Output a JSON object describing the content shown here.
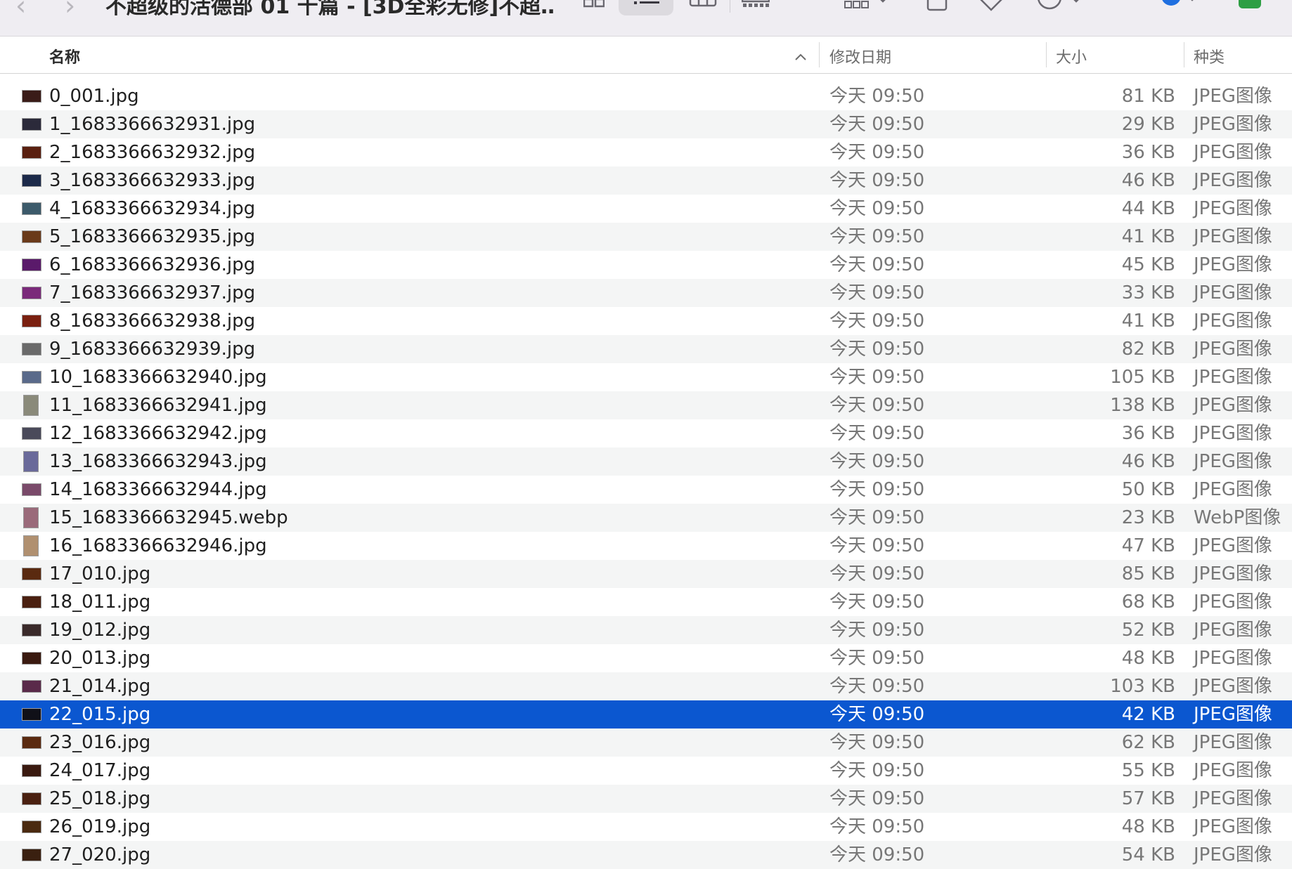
{
  "toolbar": {
    "back_glyph": "‹",
    "forward_glyph": "›",
    "title": "不超级的活德部 01 十篇 - [3D全彩无修]不超…",
    "view_icons": [
      "grid-view-icon",
      "list-view-icon",
      "column-view-icon",
      "gallery-view-icon"
    ],
    "active_view": "list"
  },
  "columns": {
    "name": "名称",
    "date": "修改日期",
    "size": "大小",
    "kind": "种类"
  },
  "colors": {
    "selection": "#0b57d0",
    "alt_row": "#f4f5f5",
    "toolbar_bg": "#efedf2"
  },
  "files": [
    {
      "name": "0_001.jpg",
      "date": "今天 09:50",
      "size": "81 KB",
      "kind": "JPEG图像",
      "thumb": "#3a1c18"
    },
    {
      "name": "1_1683366632931.jpg",
      "date": "今天 09:50",
      "size": "29 KB",
      "kind": "JPEG图像",
      "thumb": "#2b2a3a"
    },
    {
      "name": "2_1683366632932.jpg",
      "date": "今天 09:50",
      "size": "36 KB",
      "kind": "JPEG图像",
      "thumb": "#5a2010"
    },
    {
      "name": "3_1683366632933.jpg",
      "date": "今天 09:50",
      "size": "46 KB",
      "kind": "JPEG图像",
      "thumb": "#1c2a4a"
    },
    {
      "name": "4_1683366632934.jpg",
      "date": "今天 09:50",
      "size": "44 KB",
      "kind": "JPEG图像",
      "thumb": "#3c5a6a"
    },
    {
      "name": "5_1683366632935.jpg",
      "date": "今天 09:50",
      "size": "41 KB",
      "kind": "JPEG图像",
      "thumb": "#6a3a1a"
    },
    {
      "name": "6_1683366632936.jpg",
      "date": "今天 09:50",
      "size": "45 KB",
      "kind": "JPEG图像",
      "thumb": "#5a1a6a"
    },
    {
      "name": "7_1683366632937.jpg",
      "date": "今天 09:50",
      "size": "33 KB",
      "kind": "JPEG图像",
      "thumb": "#7a2a7a"
    },
    {
      "name": "8_1683366632938.jpg",
      "date": "今天 09:50",
      "size": "41 KB",
      "kind": "JPEG图像",
      "thumb": "#7a2010"
    },
    {
      "name": "9_1683366632939.jpg",
      "date": "今天 09:50",
      "size": "82 KB",
      "kind": "JPEG图像",
      "thumb": "#6a6a6a"
    },
    {
      "name": "10_1683366632940.jpg",
      "date": "今天 09:50",
      "size": "105 KB",
      "kind": "JPEG图像",
      "thumb": "#5a6a8a"
    },
    {
      "name": "11_1683366632941.jpg",
      "date": "今天 09:50",
      "size": "138 KB",
      "kind": "JPEG图像",
      "thumb": "#8a8a7a",
      "tall": true
    },
    {
      "name": "12_1683366632942.jpg",
      "date": "今天 09:50",
      "size": "36 KB",
      "kind": "JPEG图像",
      "thumb": "#4a4a5a"
    },
    {
      "name": "13_1683366632943.jpg",
      "date": "今天 09:50",
      "size": "46 KB",
      "kind": "JPEG图像",
      "thumb": "#6a6a9a",
      "tall": true
    },
    {
      "name": "14_1683366632944.jpg",
      "date": "今天 09:50",
      "size": "50 KB",
      "kind": "JPEG图像",
      "thumb": "#7a4a6a"
    },
    {
      "name": "15_1683366632945.webp",
      "date": "今天 09:50",
      "size": "23 KB",
      "kind": "WebP图像",
      "thumb": "#9a6a7a",
      "tall": true
    },
    {
      "name": "16_1683366632946.jpg",
      "date": "今天 09:50",
      "size": "47 KB",
      "kind": "JPEG图像",
      "thumb": "#b09070",
      "tall": true
    },
    {
      "name": "17_010.jpg",
      "date": "今天 09:50",
      "size": "85 KB",
      "kind": "JPEG图像",
      "thumb": "#5a2a10"
    },
    {
      "name": "18_011.jpg",
      "date": "今天 09:50",
      "size": "68 KB",
      "kind": "JPEG图像",
      "thumb": "#4a2010"
    },
    {
      "name": "19_012.jpg",
      "date": "今天 09:50",
      "size": "52 KB",
      "kind": "JPEG图像",
      "thumb": "#3a2a2a"
    },
    {
      "name": "20_013.jpg",
      "date": "今天 09:50",
      "size": "48 KB",
      "kind": "JPEG图像",
      "thumb": "#3a1a10"
    },
    {
      "name": "21_014.jpg",
      "date": "今天 09:50",
      "size": "103 KB",
      "kind": "JPEG图像",
      "thumb": "#5a2a4a"
    },
    {
      "name": "22_015.jpg",
      "date": "今天 09:50",
      "size": "42 KB",
      "kind": "JPEG图像",
      "thumb": "#101018",
      "selected": true
    },
    {
      "name": "23_016.jpg",
      "date": "今天 09:50",
      "size": "62 KB",
      "kind": "JPEG图像",
      "thumb": "#5a2a10"
    },
    {
      "name": "24_017.jpg",
      "date": "今天 09:50",
      "size": "55 KB",
      "kind": "JPEG图像",
      "thumb": "#3a1a10"
    },
    {
      "name": "25_018.jpg",
      "date": "今天 09:50",
      "size": "57 KB",
      "kind": "JPEG图像",
      "thumb": "#4a2010"
    },
    {
      "name": "26_019.jpg",
      "date": "今天 09:50",
      "size": "48 KB",
      "kind": "JPEG图像",
      "thumb": "#4a2a10"
    },
    {
      "name": "27_020.jpg",
      "date": "今天 09:50",
      "size": "54 KB",
      "kind": "JPEG图像",
      "thumb": "#3a2010"
    }
  ]
}
